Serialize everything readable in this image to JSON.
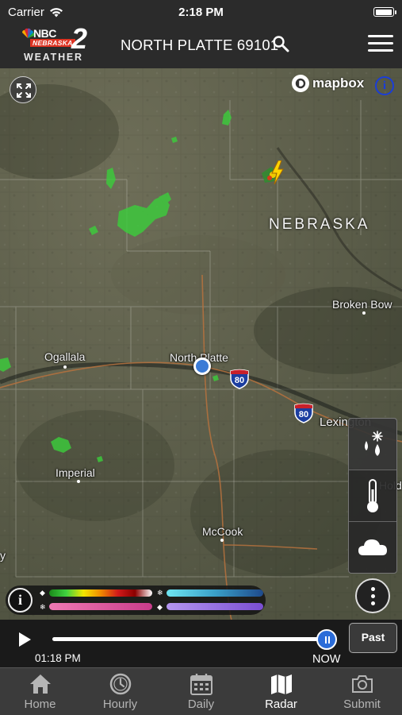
{
  "status_bar": {
    "carrier": "Carrier",
    "time": "2:18 PM",
    "battery_level": 1.0
  },
  "header": {
    "logo": {
      "nbc": "NBC",
      "state": "NEBRASKA",
      "number": "2",
      "weather": "WEATHER"
    },
    "location": "NORTH PLATTE 69101",
    "icons": {
      "search": "search-icon",
      "menu": "hamburger-menu-icon"
    }
  },
  "map": {
    "attribution": "mapbox",
    "state_label": "NEBRASKA",
    "cities": [
      "Ogallala",
      "North Platte",
      "Broken Bow",
      "Lexington",
      "Imperial",
      "McCook",
      "y",
      "Hold"
    ],
    "highways": [
      "80",
      "80"
    ],
    "icons": {
      "expand": "expand-icon",
      "info": "info-icon",
      "lightning": "lightning-icon",
      "location": "current-location-icon"
    }
  },
  "layers": {
    "items": [
      {
        "name": "precipitation",
        "icon": "snow-rain-icon"
      },
      {
        "name": "temperature",
        "icon": "thermometer-icon"
      },
      {
        "name": "clouds",
        "icon": "cloud-icon"
      }
    ],
    "more_icon": "more-vertical-icon"
  },
  "legend": {
    "info_icon": "info-icon",
    "bars": [
      {
        "name": "rain",
        "colors": [
          "#1a8a1a",
          "#3fd23f",
          "#f2e600",
          "#f08a00",
          "#d21a1a",
          "#8a0000",
          "#ffffff"
        ]
      },
      {
        "name": "snow",
        "colors": [
          "#6ee6f2",
          "#3aa0c8",
          "#1e4a8c"
        ]
      },
      {
        "name": "mix",
        "colors": [
          "#f07ab4",
          "#c83c8a"
        ]
      },
      {
        "name": "ice",
        "colors": [
          "#b496f0",
          "#7a4ed2"
        ]
      }
    ]
  },
  "timeline": {
    "start_time": "01:18 PM",
    "end_label": "NOW",
    "past_label": "Past",
    "progress": 1.0,
    "play_icon": "play-icon"
  },
  "tabs": [
    {
      "label": "Home",
      "icon": "home-icon",
      "active": false
    },
    {
      "label": "Hourly",
      "icon": "clock-icon",
      "active": false
    },
    {
      "label": "Daily",
      "icon": "calendar-icon",
      "active": false
    },
    {
      "label": "Radar",
      "icon": "map-icon",
      "active": true
    },
    {
      "label": "Submit",
      "icon": "camera-icon",
      "active": false
    }
  ]
}
